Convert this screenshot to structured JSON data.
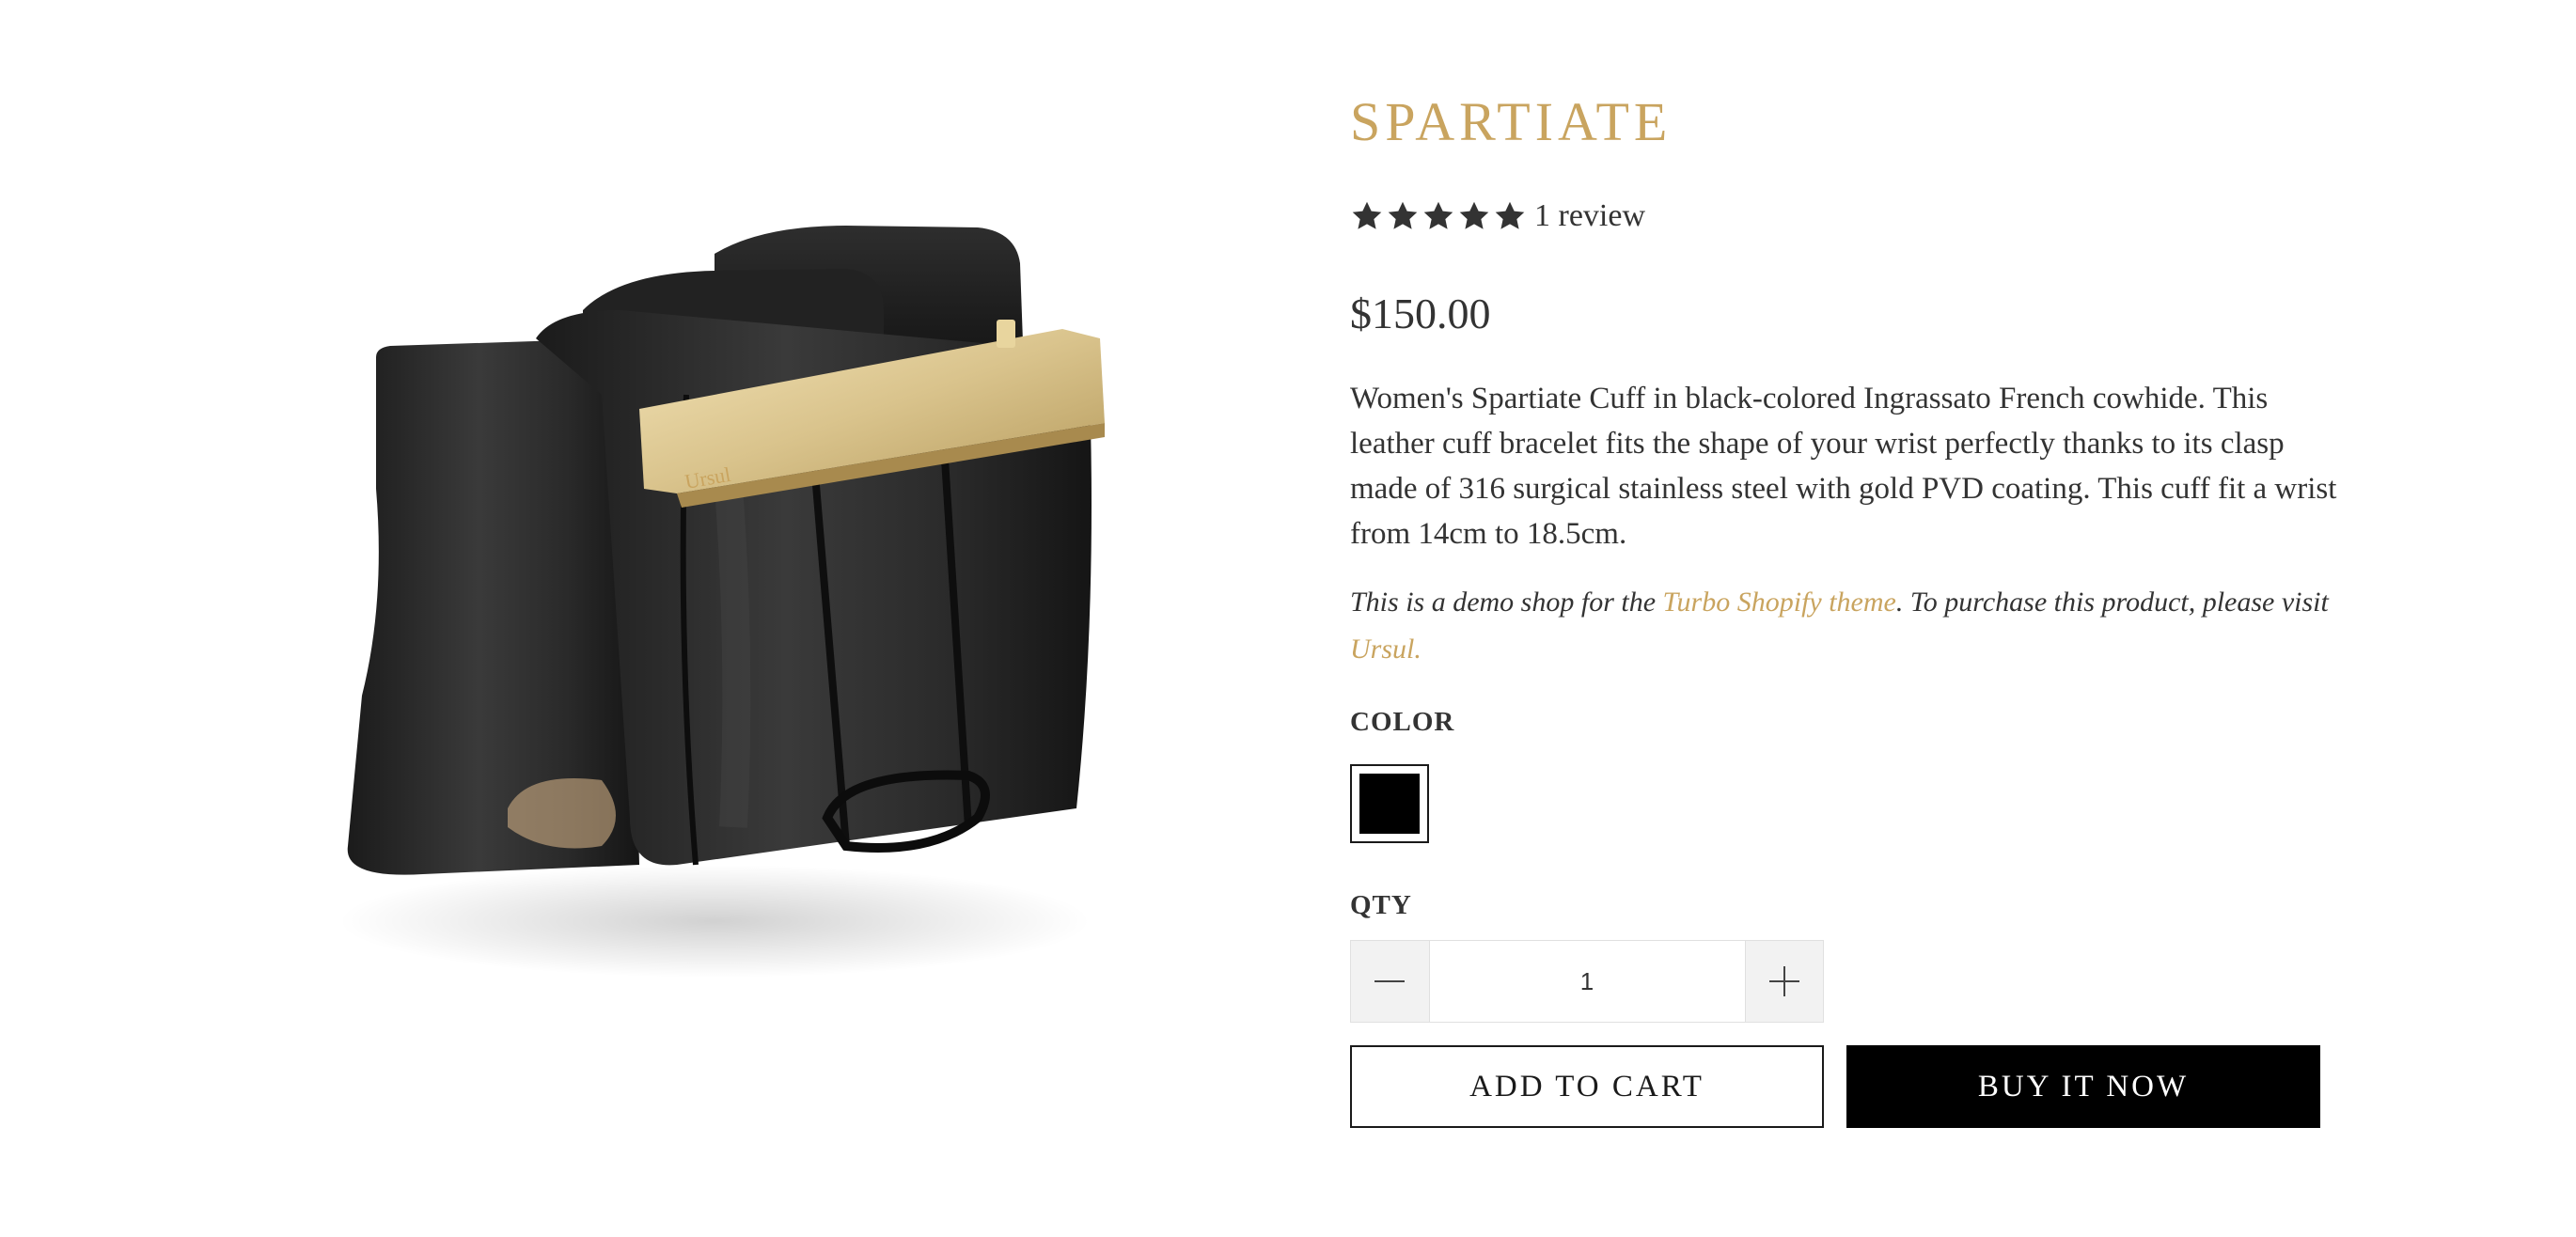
{
  "product": {
    "title": "SPARTIATE",
    "rating": 5,
    "rating_max": 5,
    "review_count": "1 review",
    "price": "$150.00",
    "description": "Women's Spartiate Cuff in black-colored Ingrassato French cowhide. This leather cuff bracelet fits the shape of your wrist perfectly thanks to its clasp made of 316 surgical stainless steel with gold PVD coating. This cuff fit a wrist from 14cm to 18.5cm.",
    "image_icon": "leather-cuff-bracelet-image",
    "image_brand_mark": "Ursul"
  },
  "demo_note": {
    "prefix": "This is a demo shop for the ",
    "theme_link": "Turbo Shopify theme",
    "middle": ". To purchase this product, please visit ",
    "vendor_link": "Ursul."
  },
  "options": {
    "color_label": "COLOR",
    "color_swatches": [
      {
        "name": "Black",
        "hex": "#000000",
        "selected": true
      }
    ],
    "qty_label": "QTY",
    "qty_value": "1"
  },
  "actions": {
    "add_to_cart": "ADD TO CART",
    "buy_now": "BUY IT NOW"
  },
  "colors": {
    "accent_gold": "#c9a45f",
    "text": "#333333",
    "button_dark": "#000000"
  },
  "icons": {
    "star": "star-icon",
    "minus": "minus-icon",
    "plus": "plus-icon"
  }
}
